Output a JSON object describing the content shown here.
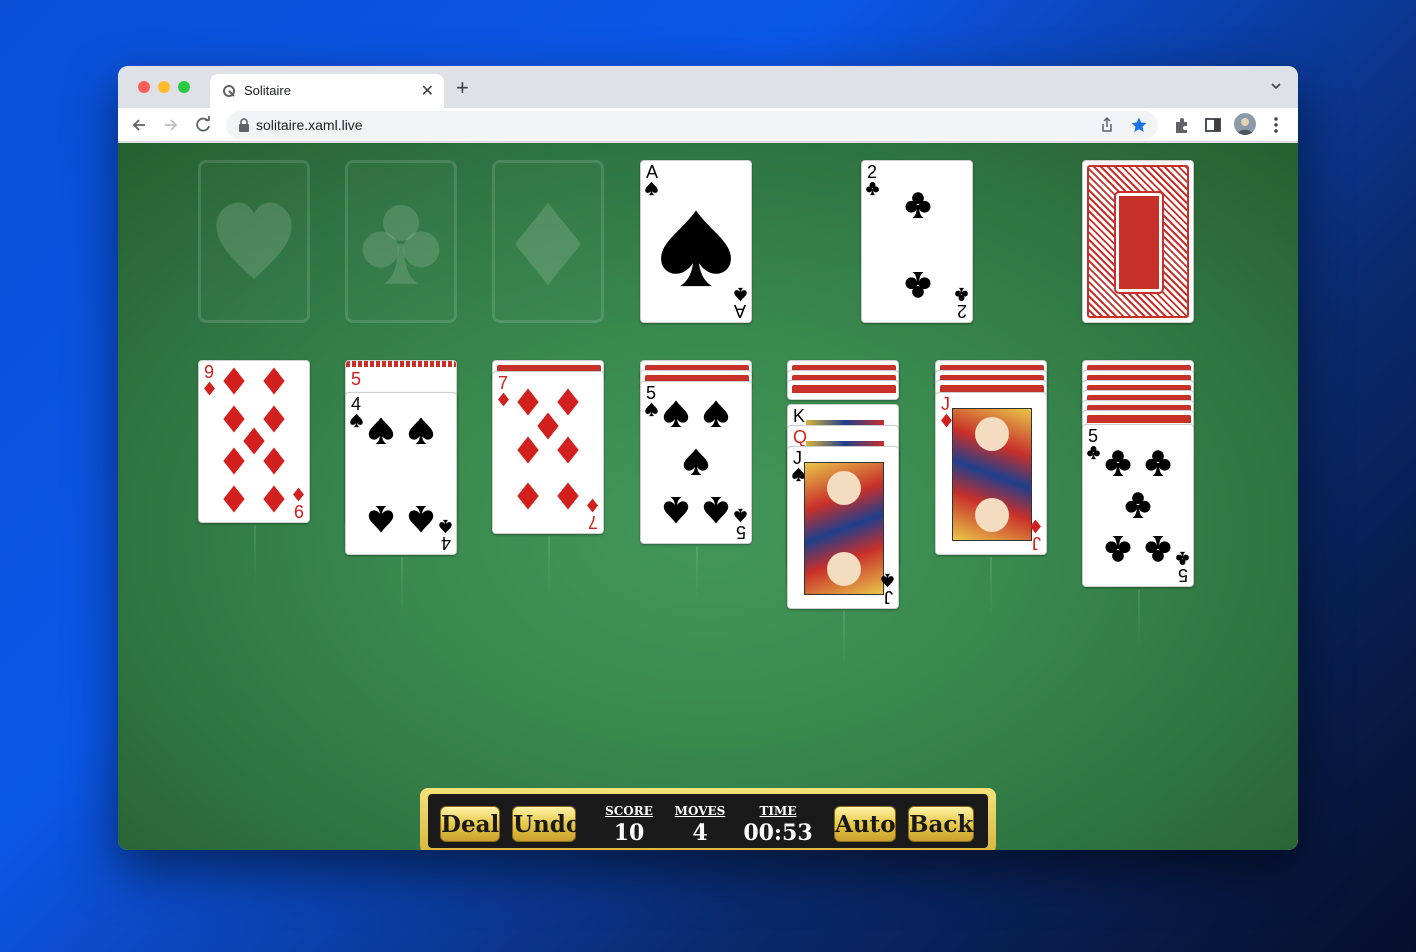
{
  "browser": {
    "tab_title": "Solitaire",
    "url": "solitaire.xaml.live"
  },
  "colors": {
    "felt": "#3a8a50",
    "card_red": "#d1201d",
    "card_back": "#c8302a",
    "hud_gold": "#e8c84a"
  },
  "foundations": [
    {
      "suit": "heart-icon"
    },
    {
      "suit": "club-icon"
    },
    {
      "suit": "diamond-icon"
    }
  ],
  "top_cards": {
    "ace_spades": {
      "rank": "A",
      "suit": "spade"
    },
    "two_clubs": {
      "rank": "2",
      "suit": "club"
    }
  },
  "tableau": {
    "col1": {
      "rank": "9",
      "suit": "diamond"
    },
    "col2_hidden": {
      "rank": "5"
    },
    "col2": {
      "rank": "4",
      "suit": "spade"
    },
    "col3": {
      "rank": "7",
      "suit": "diamond"
    },
    "col4": {
      "rank": "5",
      "suit": "spade"
    },
    "col5_k": {
      "rank": "K"
    },
    "col5_q": {
      "rank": "Q"
    },
    "col5": {
      "rank": "J",
      "suit": "spade"
    },
    "col6": {
      "rank": "J",
      "suit": "diamond"
    },
    "col7": {
      "rank": "5",
      "suit": "club"
    }
  },
  "hud": {
    "deal": "Deal",
    "undo": "Undo",
    "score_label": "SCORE",
    "score": "10",
    "moves_label": "MOVES",
    "moves": "4",
    "time_label": "TIME",
    "time": "00:53",
    "auto": "Auto",
    "back": "Back"
  }
}
